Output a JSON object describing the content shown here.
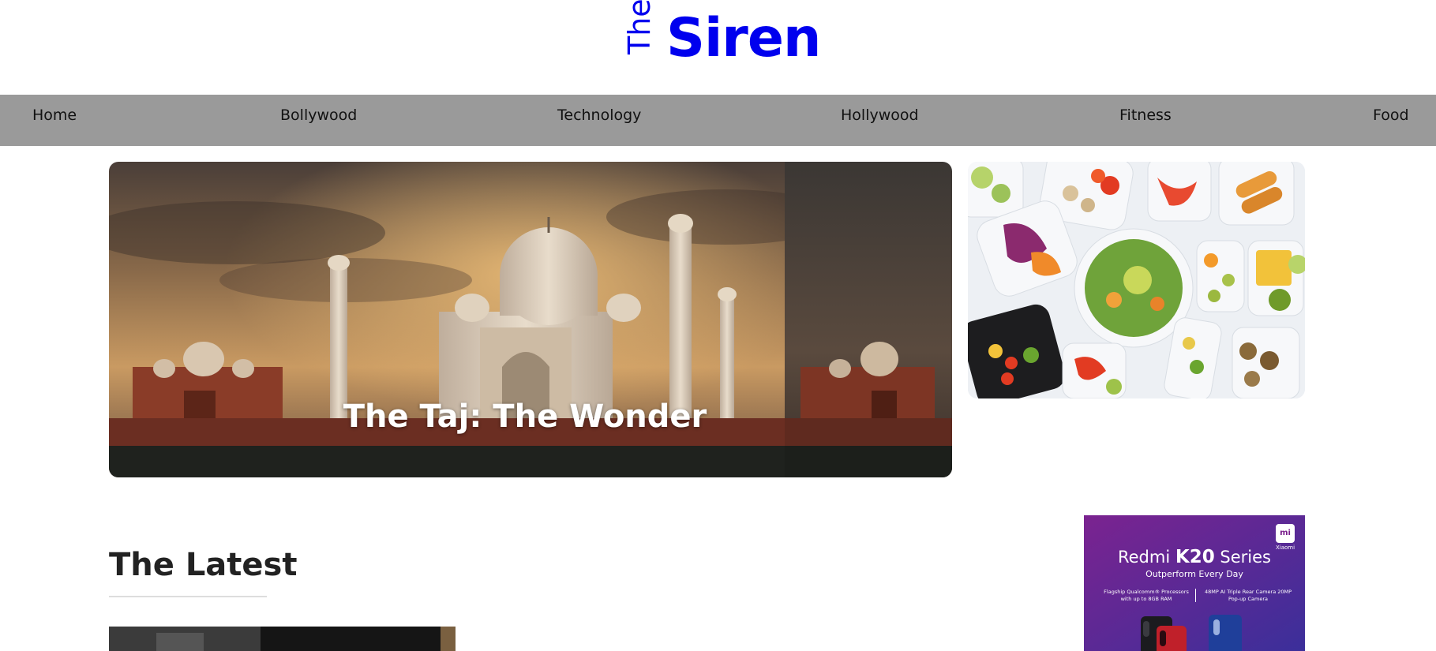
{
  "logo": {
    "prefix": "The",
    "name": "Siren",
    "color": "#0000ee"
  },
  "nav": {
    "background": "#9a9a9a",
    "items": [
      {
        "label": "Home"
      },
      {
        "label": "Bollywood"
      },
      {
        "label": "Technology"
      },
      {
        "label": "Hollywood"
      },
      {
        "label": "Fitness"
      },
      {
        "label": "Food"
      }
    ]
  },
  "hero": {
    "title": "The Taj: The Wonder",
    "image": "taj-mahal-sunset-photo"
  },
  "side_feature": {
    "image": "healthy-food-containers-photo"
  },
  "latest": {
    "heading": "The Latest",
    "thumb_image": "dark-photo-thumbnail"
  },
  "ad": {
    "brand_prefix": "Redmi",
    "brand_model": "K20",
    "brand_suffix": "Series",
    "tagline": "Outperform Every Day",
    "feature_left": "Flagship Qualcomm® Processors with up to 8GB RAM",
    "feature_right": "48MP AI Triple Rear Camera 20MP Pop-up Camera",
    "logo_mark": "mi",
    "logo_caption": "Xiaomi",
    "gradient_start": "#7b2390",
    "gradient_end": "#3b2f9a"
  }
}
